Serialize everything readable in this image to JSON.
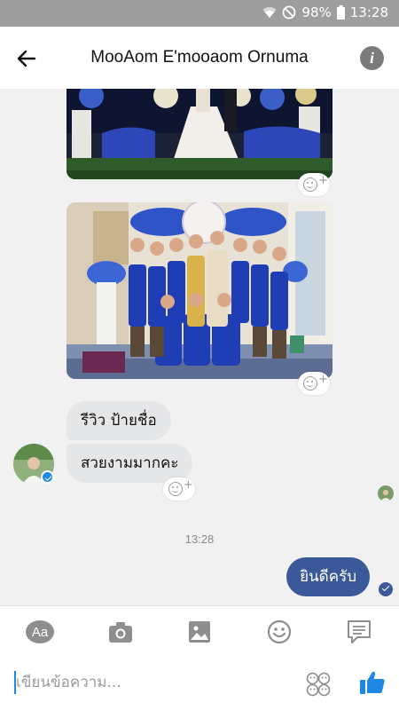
{
  "status_bar": {
    "battery": "98%",
    "time": "13:28",
    "icons": [
      "wifi-icon",
      "do-not-disturb-icon",
      "battery-icon"
    ]
  },
  "header": {
    "title": "MooAom E'mooaom Ornuma",
    "back_icon": "back-arrow-icon",
    "info_label": "i"
  },
  "messages": {
    "received": [
      {
        "text": "รีวิว ป้ายชื่อ"
      },
      {
        "text": "สวยงามมากคะ"
      }
    ],
    "timestamp": "13:28",
    "sent": {
      "text": "ยินดีครับ"
    }
  },
  "toolbar": {
    "aa_label": "Aa",
    "icons": [
      "text-format-icon",
      "camera-icon",
      "gallery-icon",
      "emoji-icon",
      "more-icon"
    ]
  },
  "composer": {
    "placeholder": "เขียนข้อความ..."
  },
  "colors": {
    "sent_bubble": "#3b5998",
    "received_bubble": "#e4e6e8",
    "like_icon": "#1e88e5",
    "status_bar": "#9e9e9e"
  }
}
